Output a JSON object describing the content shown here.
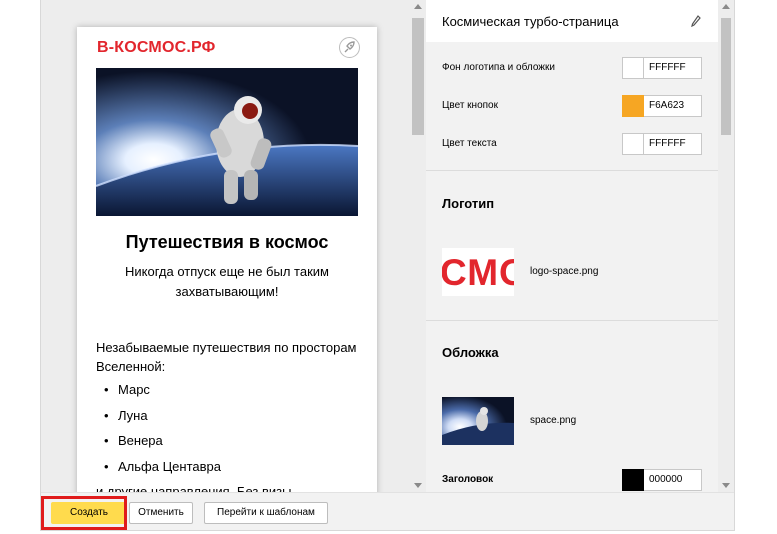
{
  "preview": {
    "logo_text": "В-КОСМОС.РФ",
    "title": "Путешествия в космос",
    "subtitle": "Никогда отпуск еще не был таким захватывающим!",
    "body": "Незабываемые путешествия по просторам Вселенной:",
    "list": [
      "Марс",
      "Луна",
      "Венера",
      "Альфа Центавра"
    ],
    "more_text": "и другие направления. Без визы."
  },
  "settings": {
    "title": "Космическая турбо-страница",
    "colors": [
      {
        "label": "Фон логотипа и обложки",
        "hex": "FFFFFF",
        "swatch": "#FFFFFF"
      },
      {
        "label": "Цвет кнопок",
        "hex": "F6A623",
        "swatch": "#F6A623"
      },
      {
        "label": "Цвет текста",
        "hex": "FFFFFF",
        "swatch": "#FFFFFF"
      }
    ],
    "logo_section": {
      "title": "Логотип",
      "thumb_text": "СМО",
      "filename": "logo-space.png"
    },
    "cover_section": {
      "title": "Обложка",
      "filename": "space.png"
    },
    "heading_color": {
      "label": "Заголовок",
      "hex": "000000",
      "swatch": "#000000"
    }
  },
  "toolbar": {
    "create_label": "Создать",
    "cancel_label": "Отменить",
    "templates_label": "Перейти к шаблонам"
  },
  "colors": {
    "brand_red": "#E2262D",
    "create_yellow": "#FFDB4D",
    "highlight_red": "#E01B1B"
  }
}
